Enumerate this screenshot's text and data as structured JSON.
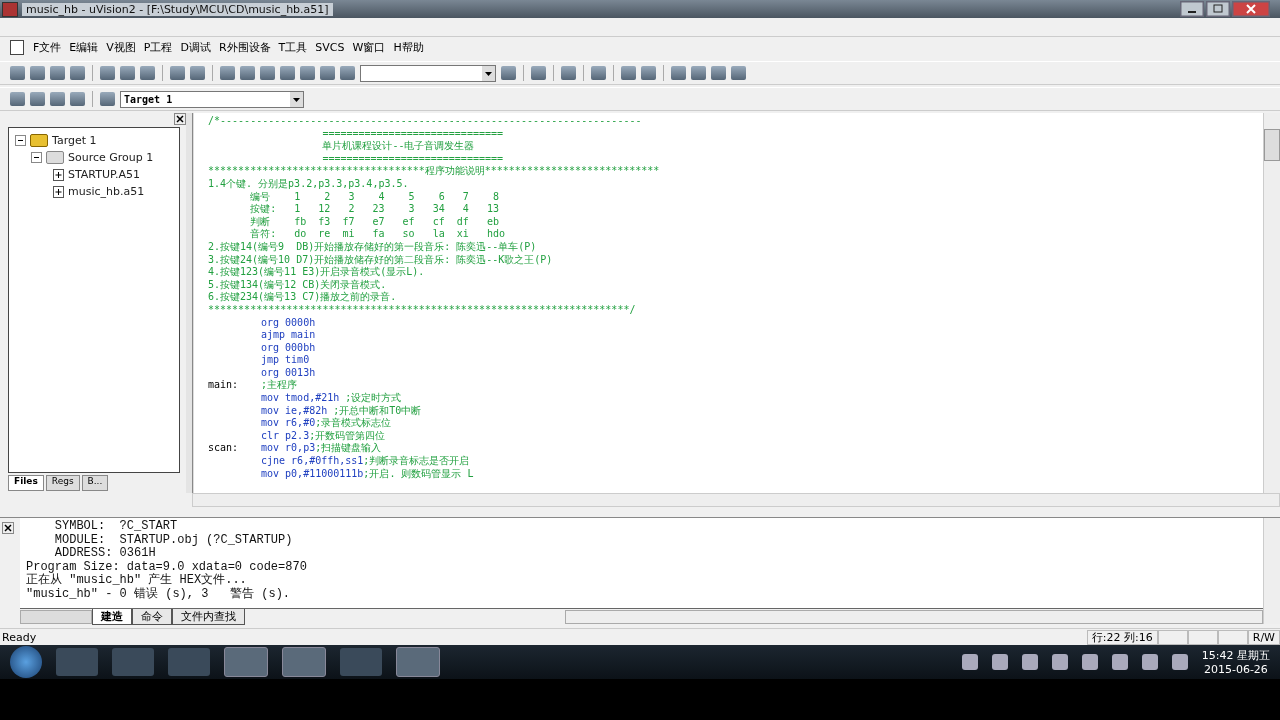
{
  "window": {
    "title": "music_hb  - uVision2 - [F:\\Study\\MCU\\CD\\music_hb.a51]"
  },
  "menu": [
    "F文件",
    "E编辑",
    "V视图",
    "P工程",
    "D调试",
    "R外围设备",
    "T工具",
    "SVCS",
    "W窗口",
    "H帮助"
  ],
  "target_select": {
    "value": "Target 1"
  },
  "project_tree": [
    {
      "label": "Target 1",
      "expanded": true,
      "children": [
        {
          "label": "Source Group 1",
          "expanded": true,
          "children": [
            {
              "label": "STARTUP.A51"
            },
            {
              "label": "music_hb.a51"
            }
          ]
        }
      ]
    }
  ],
  "panel_tabs": [
    {
      "label": "Files",
      "selected": true
    },
    {
      "label": "Regs",
      "selected": false
    },
    {
      "label": "B...",
      "selected": false
    }
  ],
  "header_lines": [
    "/*----------------------------------------------------------------------",
    "                   ==============================",
    "                   单片机课程设计--电子音调发生器",
    "                   ==============================",
    "************************************程序功能说明*****************************",
    "1.4个键. 分别是p3.2,p3.3,p3.4,p3.5.",
    "       编号    1    2   3    4    5    6   7    8",
    "       按键:   1   12   2   23    3   34   4   13",
    "       判断    fb  f3  f7   e7   ef   cf  df   eb",
    "       音符:   do  re  mi   fa   so   la  xi   hdo",
    "2.按键14(编号9  DB)开始播放存储好的第一段音乐: 陈奕迅--单车(P)",
    "3.按键24(编号10 D7)开始播放储存好的第二段音乐: 陈奕迅--K歌之王(P)",
    "4.按键123(编号11 E3)开启录音模式(显示L).",
    "5.按键134(编号12 CB)关闭录音模式.",
    "6.按键234(编号13 C7)播放之前的录音.",
    "**********************************************************************/"
  ],
  "code_lines": [
    {
      "instr": "org 0000h"
    },
    {
      "instr": "ajmp main"
    },
    {
      "instr": "org 000bh"
    },
    {
      "instr": "jmp tim0"
    },
    {
      "instr": "org 0013h"
    },
    {
      "label": "main:",
      "comment": ";主程序"
    },
    {
      "instr": "mov tmod,#21h ",
      "comment": ";设定时方式"
    },
    {
      "instr": "mov ie,#82h ",
      "comment": ";开总中断和T0中断"
    },
    {
      "instr": "mov r6,#0",
      "comment": ";录音模式标志位"
    },
    {
      "instr": "clr p2.3",
      "comment": ";开数码管第四位"
    },
    {
      "label": "scan:",
      "instr": "mov r0,p3",
      "comment": ";扫描键盘输入"
    },
    {
      "instr": "cjne r6,#0ffh,ss1",
      "comment": ";判断录音标志是否开启"
    },
    {
      "instr": "mov p0,#11000111b",
      "comment": ";开启. 则数码管显示 L"
    }
  ],
  "output_lines": [
    "    SYMBOL:  ?C_START",
    "    MODULE:  STARTUP.obj (?C_STARTUP)",
    "    ADDRESS: 0361H",
    "Program Size: data=9.0 xdata=0 code=870",
    "正在从 \"music_hb\" 产生 HEX文件...",
    "\"music_hb\" - 0 错误 (s), 3   警告 (s)."
  ],
  "output_tabs": [
    {
      "label": "建造",
      "selected": true
    },
    {
      "label": "命令",
      "selected": false
    },
    {
      "label": "文件内查找",
      "selected": false
    }
  ],
  "status_bar": {
    "message": "Ready",
    "position": "行:22 列:16",
    "mode": "R/W"
  },
  "taskbar": {
    "time": "15:42 星期五",
    "date": "2015-06-26"
  }
}
